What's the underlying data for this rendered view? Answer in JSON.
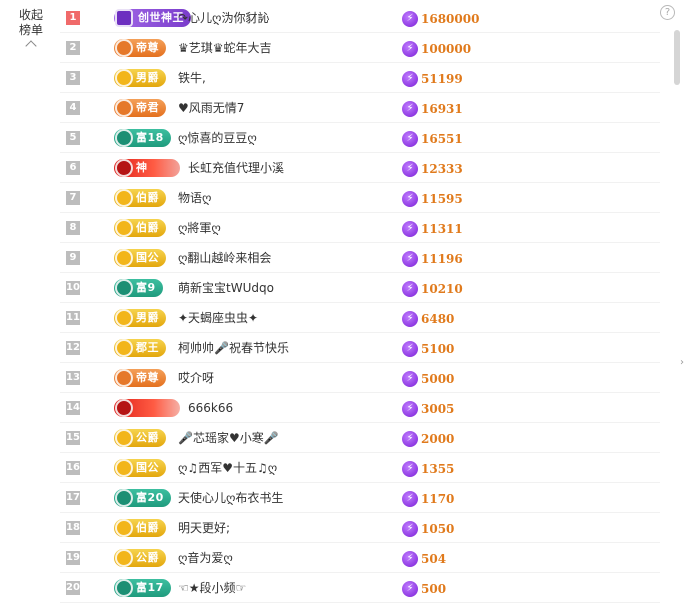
{
  "panel": {
    "collapse_label_line1": "收起",
    "collapse_label_line2": "榜单",
    "help_symbol": "?"
  },
  "ranking": [
    {
      "rank": "1",
      "badge": "创世神王",
      "badge_style": "purple",
      "name": "↷心儿ღ沩你豺訫",
      "score": "1680000"
    },
    {
      "rank": "2",
      "badge": "帝尊",
      "badge_style": "orange",
      "name": "♛艺琪♛蛇年大吉",
      "score": "100000"
    },
    {
      "rank": "3",
      "badge": "男爵",
      "badge_style": "gold",
      "name": "铁牛,",
      "score": "51199"
    },
    {
      "rank": "4",
      "badge": "帝君",
      "badge_style": "orange",
      "name": "♥风雨无情7",
      "score": "16931"
    },
    {
      "rank": "5",
      "badge": "富18",
      "badge_style": "teal",
      "name": "ღ惊喜的豆豆ღ",
      "score": "16551"
    },
    {
      "rank": "6",
      "badge": "神",
      "badge_style": "red",
      "name": "长虹充值代理小溪",
      "score": "12333"
    },
    {
      "rank": "7",
      "badge": "伯爵",
      "badge_style": "gold",
      "name": "物语ღ",
      "score": "11595"
    },
    {
      "rank": "8",
      "badge": "伯爵",
      "badge_style": "gold",
      "name": "ღ將軍ღ",
      "score": "11311"
    },
    {
      "rank": "9",
      "badge": "国公",
      "badge_style": "gold",
      "name": "ღ翻山越岭来相会",
      "score": "11196"
    },
    {
      "rank": "10",
      "badge": "富9",
      "badge_style": "teal",
      "name": "萌新宝宝tWUdqo",
      "score": "10210"
    },
    {
      "rank": "11",
      "badge": "男爵",
      "badge_style": "gold",
      "name": "✦天蝎座虫虫✦",
      "score": "6480"
    },
    {
      "rank": "12",
      "badge": "郡王",
      "badge_style": "gold",
      "name": "柯帅帅🎤祝春节快乐",
      "score": "5100"
    },
    {
      "rank": "13",
      "badge": "帝尊",
      "badge_style": "orange",
      "name": "哎介呀",
      "score": "5000"
    },
    {
      "rank": "14",
      "badge": "",
      "badge_style": "red2",
      "name": "666k66",
      "score": "3005"
    },
    {
      "rank": "15",
      "badge": "公爵",
      "badge_style": "gold",
      "name": "🎤芯瑶家♥小寒🎤",
      "score": "2000"
    },
    {
      "rank": "16",
      "badge": "国公",
      "badge_style": "gold",
      "name": "ღ♫西军♥十五♫ღ",
      "score": "1355"
    },
    {
      "rank": "17",
      "badge": "富20",
      "badge_style": "teal",
      "name": "天使心儿ღ布衣书生",
      "score": "1170"
    },
    {
      "rank": "18",
      "badge": "伯爵",
      "badge_style": "gold",
      "name": "明天更好;",
      "score": "1050"
    },
    {
      "rank": "19",
      "badge": "公爵",
      "badge_style": "gold",
      "name": "ღ音为爱ღ",
      "score": "504"
    },
    {
      "rank": "20",
      "badge": "富17",
      "badge_style": "teal",
      "name": "☜★段小频☞",
      "score": "500"
    }
  ],
  "colors": {
    "score_text": "#e07a1c",
    "rank1_bg": "#f06a6a",
    "rank_bg": "#bdbdbd",
    "bolt": "#8a2be2"
  },
  "icons": {
    "score_icon": "lightning-bolt-icon",
    "collapse_icon": "chevron-up-icon",
    "help_icon": "question-circle-icon"
  }
}
